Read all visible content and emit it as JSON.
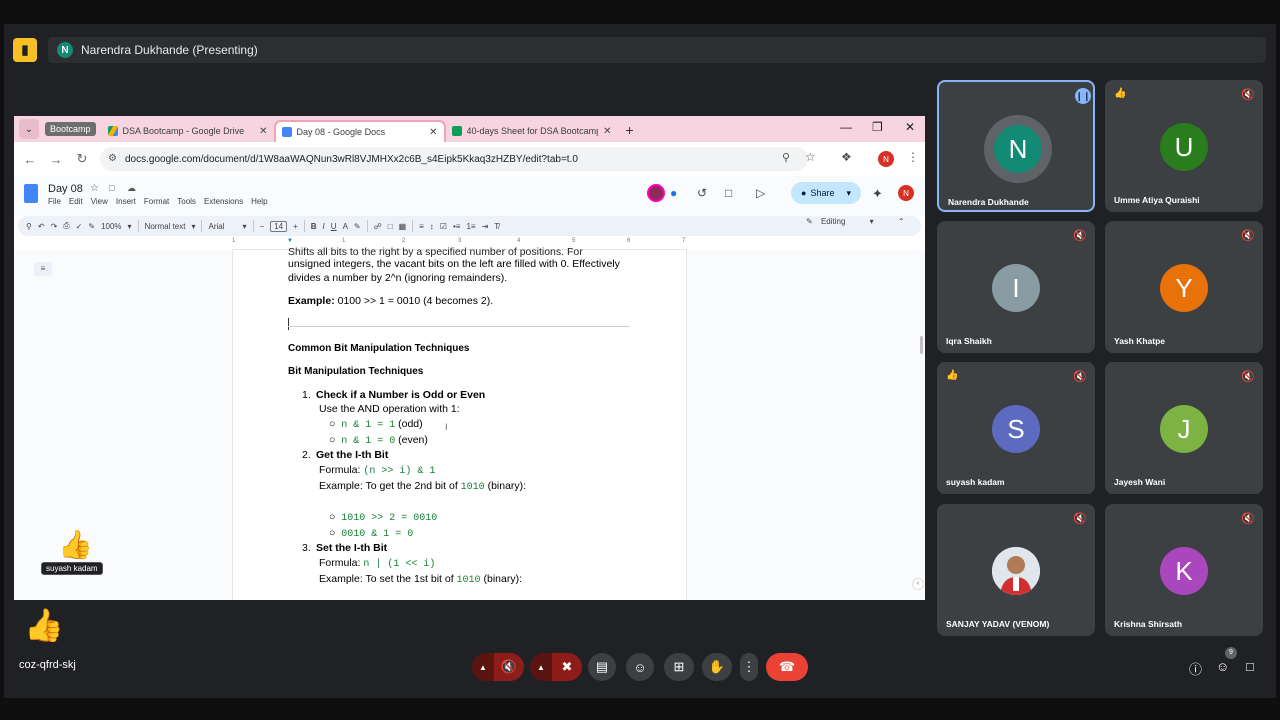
{
  "presenting": {
    "avatar_letter": "N",
    "name": "Narendra Dukhande (Presenting)"
  },
  "browser": {
    "group_label": "Bootcamp",
    "tabs": [
      {
        "label": "DSA Bootcamp - Google Drive",
        "color": "#1a73e8"
      },
      {
        "label": "Day 08 - Google Docs",
        "color": "#4285f4"
      },
      {
        "label": "40-days Sheet for DSA Bootcamp",
        "color": "#0f9d58"
      }
    ],
    "url": "docs.google.com/document/d/1W8aaWAQNun3wRl8VJMHXx2c6B_s4Eipk5Kkaq3zHZBY/edit?tab=t.0"
  },
  "docs": {
    "title": "Day 08",
    "menu": [
      "File",
      "Edit",
      "View",
      "Insert",
      "Format",
      "Tools",
      "Extensions",
      "Help"
    ],
    "share_label": "Share",
    "user_initial": "N",
    "zoom": "100%",
    "style": "Normal text",
    "font": "Arial",
    "font_size": "14",
    "mode": "Editing",
    "ruler": [
      "1",
      "1",
      "2",
      "3",
      "4",
      "5",
      "6",
      "7"
    ]
  },
  "content": {
    "l1": "Shifts all bits to the right by a specified number of positions. For",
    "l2": "unsigned integers, the vacant bits on the left are filled with 0. Effectively",
    "l3": "divides a number by 2^n (ignoring remainders).",
    "ex_label": "Example:",
    "ex_text": " 0100 >> 1 = 0010 (4 becomes 2).",
    "h1": "Common Bit Manipulation Techniques",
    "h2": "Bit Manipulation Techniques",
    "i1_num": "1.",
    "i1_title": "Check if a Number is Odd or Even",
    "i1_desc": "Use the AND operation with 1:",
    "i1_a_code": "n & 1 = 1",
    "i1_a_text": " (odd)",
    "i1_b_code": "n & 1 = 0",
    "i1_b_text": " (even)",
    "i2_num": "2.",
    "i2_title": "Get the I-th Bit",
    "formula_label": "Formula: ",
    "i2_formula": "(n >> i) & 1",
    "i2_ex_a": "Example: To get the 2nd bit of ",
    "i2_ex_code": "1010",
    "i2_ex_b": " (binary):",
    "i2_s1": "1010 >> 2 = 0010",
    "i2_s2": "0010 & 1 = 0",
    "i3_num": "3.",
    "i3_title": "Set the I-th Bit",
    "i3_formula": "n | (1 << i)",
    "i3_ex_a": "Example: To set the 1st bit of ",
    "i3_ex_code": "1010",
    "i3_ex_b": " (binary):"
  },
  "participants": [
    {
      "initial": "N",
      "name": "Narendra Dukhande",
      "color": "#138a73",
      "state": "speaking"
    },
    {
      "initial": "U",
      "name": "Umme Atiya Quraishi",
      "color": "#2a7d1c",
      "state": "hand"
    },
    {
      "initial": "I",
      "name": "Iqra Shaikh",
      "color": "#8a9ca3",
      "state": "muted"
    },
    {
      "initial": "Y",
      "name": "Yash Khatpe",
      "color": "#e8710a",
      "state": "muted"
    },
    {
      "initial": "S",
      "name": "suyash kadam",
      "color": "#5c6bc0",
      "state": "hand"
    },
    {
      "initial": "J",
      "name": "Jayesh Wani",
      "color": "#7cb342",
      "state": "muted"
    },
    {
      "initial": "",
      "name": "SANJAY YADAV (VENOM)",
      "color": "#dfe7ec",
      "state": "muted"
    },
    {
      "initial": "K",
      "name": "Krishna Shirsath",
      "color": "#ab47bc",
      "state": "muted"
    }
  ],
  "reaction": {
    "name": "suyash kadam"
  },
  "meeting_code": "coz-qfrd-skj",
  "people_count": "9"
}
